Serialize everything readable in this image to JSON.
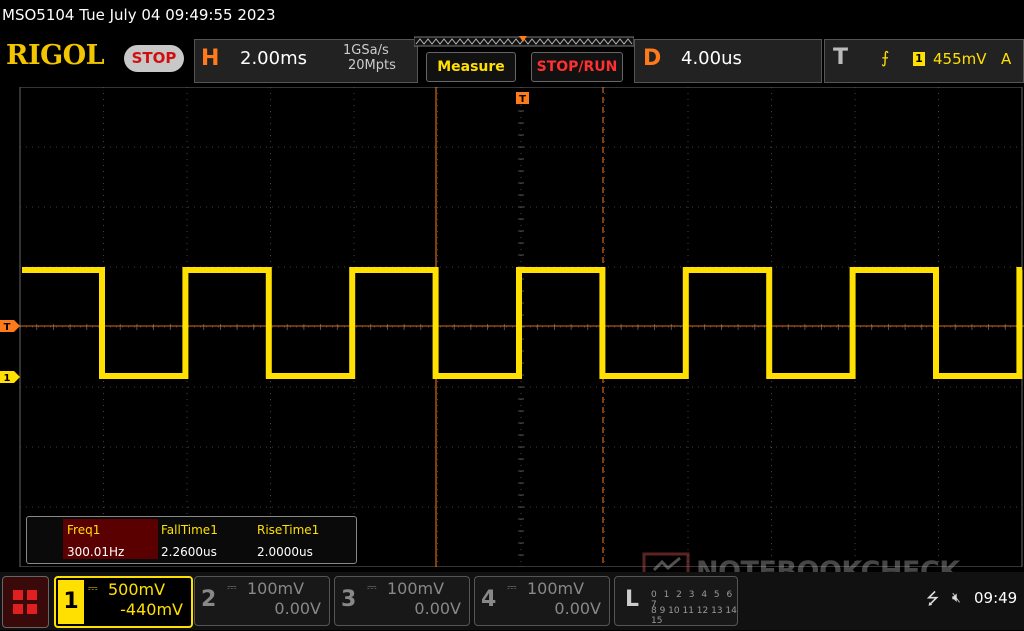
{
  "header": {
    "title": "MSO5104  Tue July 04 09:49:55 2023"
  },
  "brand": {
    "logo_text": "RIGOL",
    "run_state": "STOP"
  },
  "horizontal": {
    "letter": "H",
    "timebase": "2.00ms",
    "sample_rate": "1GSa/s",
    "memory_depth": "20Mpts"
  },
  "buttons": {
    "measure": "Measure",
    "stop_run": "STOP/RUN"
  },
  "delay": {
    "letter": "D",
    "value": "4.00us"
  },
  "trigger": {
    "letter": "T",
    "source": "1",
    "level": "455mV",
    "mode": "A",
    "edge_icon": "rising-edge-icon"
  },
  "markers": {
    "trigger_marker": "T",
    "ch1_marker": "1"
  },
  "measurements": [
    {
      "name": "Freq1",
      "value": "300.01Hz"
    },
    {
      "name": "FallTime1",
      "value": "2.2600us"
    },
    {
      "name": "RiseTime1",
      "value": "2.0000us"
    }
  ],
  "channels": [
    {
      "num": "1",
      "scale": "500mV",
      "offset": "-440mV",
      "color": "#ffe000"
    },
    {
      "num": "2",
      "scale": "100mV",
      "offset": "0.00V",
      "color": "#888888"
    },
    {
      "num": "3",
      "scale": "100mV",
      "offset": "0.00V",
      "color": "#888888"
    },
    {
      "num": "4",
      "scale": "100mV",
      "offset": "0.00V",
      "color": "#888888"
    }
  ],
  "logic": {
    "letter": "L",
    "digits_row1": "0 1 2 3 4 5 6 7",
    "digits_row2": "8 9 10 11 12 13 14 15"
  },
  "status": {
    "time": "09:49"
  },
  "watermark": {
    "text": "NOTEBOOKCHECK"
  },
  "waveform": {
    "type": "square",
    "frequency_hz": 300.01,
    "high_level": "yellow-high",
    "color": "#ffe000"
  }
}
